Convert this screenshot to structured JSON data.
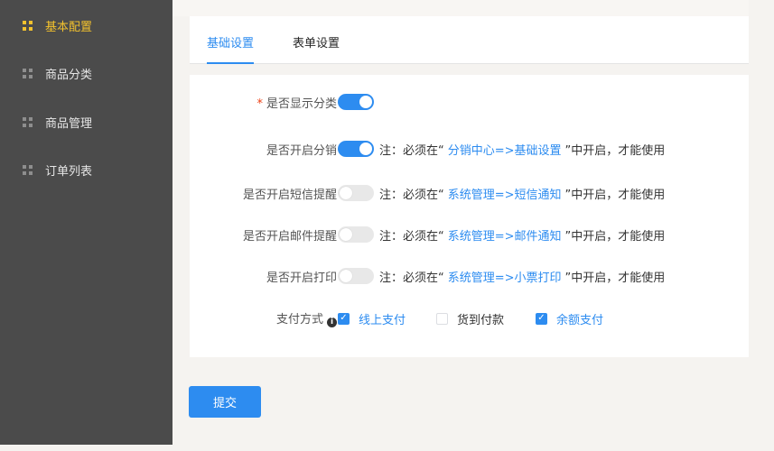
{
  "sidebar": {
    "items": [
      {
        "label": "基本配置",
        "active": true
      },
      {
        "label": "商品分类",
        "active": false
      },
      {
        "label": "商品管理",
        "active": false
      },
      {
        "label": "订单列表",
        "active": false
      }
    ]
  },
  "tabs": [
    {
      "label": "基础设置",
      "active": true
    },
    {
      "label": "表单设置",
      "active": false
    }
  ],
  "form": {
    "show_category": {
      "label": "是否显示分类",
      "required_mark": "*",
      "on": true
    },
    "distribution": {
      "label": "是否开启分销",
      "on": true,
      "note_prefix": "注：必须在“",
      "note_link": "分销中心=>基础设置",
      "note_suffix": "”中开启，才能使用"
    },
    "sms": {
      "label": "是否开启短信提醒",
      "on": false,
      "note_prefix": "注：必须在“",
      "note_link": "系统管理=>短信通知",
      "note_suffix": "”中开启，才能使用"
    },
    "email": {
      "label": "是否开启邮件提醒",
      "on": false,
      "note_prefix": "注：必须在“",
      "note_link": "系统管理=>邮件通知",
      "note_suffix": "”中开启，才能使用"
    },
    "print": {
      "label": "是否开启打印",
      "on": false,
      "note_prefix": "注：必须在“",
      "note_link": "系统管理=>小票打印",
      "note_suffix": "”中开启，才能使用"
    },
    "payment": {
      "label": "支付方式",
      "info_glyph": "i",
      "options": [
        {
          "label": "线上支付",
          "checked": true
        },
        {
          "label": "货到付款",
          "checked": false
        },
        {
          "label": "余额支付",
          "checked": true
        }
      ]
    }
  },
  "submit_label": "提交",
  "colors": {
    "accent": "#2d8cf0",
    "sidebar_bg": "#4b4b4b",
    "sidebar_active": "#f2c12e",
    "required": "#ed4014"
  }
}
